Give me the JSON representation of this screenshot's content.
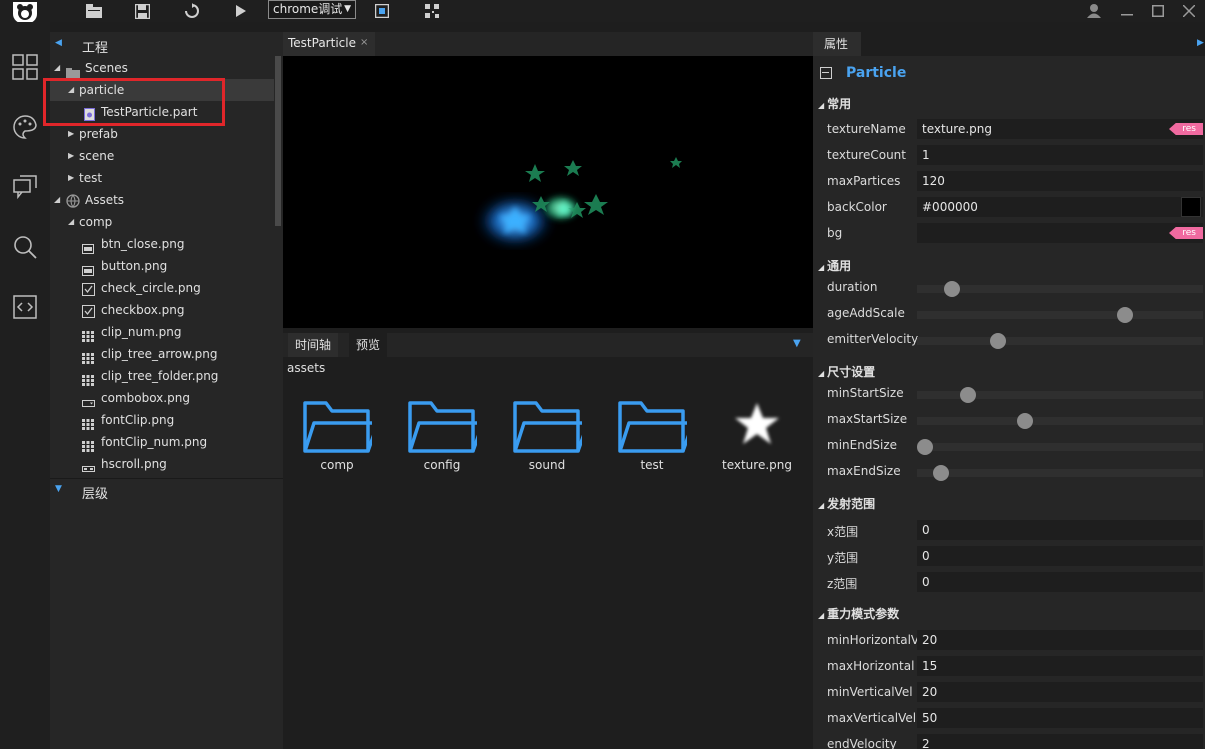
{
  "toolbar": {
    "select_value": "chrome调试",
    "caret": "▼"
  },
  "tree": {
    "header": "工程",
    "items": [
      {
        "label": "Scenes",
        "icon": "scenes-icon"
      },
      {
        "label": "particle"
      },
      {
        "label": "TestParticle.part",
        "icon": "particle-file-icon"
      },
      {
        "label": "prefab"
      },
      {
        "label": "scene"
      },
      {
        "label": "test"
      },
      {
        "label": "Assets",
        "icon": "globe-icon"
      },
      {
        "label": "comp"
      },
      {
        "label": "btn_close.png",
        "icon": "button-image-icon"
      },
      {
        "label": "button.png",
        "icon": "button-image-icon"
      },
      {
        "label": "check_circle.png",
        "icon": "checkbox-image-icon"
      },
      {
        "label": "checkbox.png",
        "icon": "checkbox-image-icon"
      },
      {
        "label": "clip_num.png",
        "icon": "clip-image-icon"
      },
      {
        "label": "clip_tree_arrow.png",
        "icon": "clip-image-icon"
      },
      {
        "label": "clip_tree_folder.png",
        "icon": "clip-image-icon"
      },
      {
        "label": "combobox.png",
        "icon": "combobox-image-icon"
      },
      {
        "label": "fontClip.png",
        "icon": "clip-image-icon"
      },
      {
        "label": "fontClip_num.png",
        "icon": "clip-image-icon"
      },
      {
        "label": "hscroll.png",
        "icon": "scroll-image-icon"
      }
    ],
    "layers_header": "层级"
  },
  "editor": {
    "tab_label": "TestParticle",
    "tab_close": "×"
  },
  "bottom": {
    "tabs": [
      "时间轴",
      "预览"
    ],
    "path": "assets",
    "assets": [
      {
        "label": "comp",
        "icon": "folder-icon"
      },
      {
        "label": "config",
        "icon": "folder-icon"
      },
      {
        "label": "sound",
        "icon": "folder-icon"
      },
      {
        "label": "test",
        "icon": "folder-icon"
      },
      {
        "label": "texture.png",
        "icon": "star-texture-icon"
      }
    ]
  },
  "props": {
    "tab": "属性",
    "component": "Particle",
    "sections": {
      "common": "常用",
      "general": "通用",
      "size": "尺寸设置",
      "emit": "发射范围",
      "gravity": "重力模式参数"
    },
    "res_tag": "res",
    "fields": {
      "textureName": {
        "label": "textureName",
        "value": "texture.png"
      },
      "textureCount": {
        "label": "textureCount",
        "value": "1"
      },
      "maxPartices": {
        "label": "maxPartices",
        "value": "120"
      },
      "backColor": {
        "label": "backColor",
        "value": "#000000"
      },
      "bg": {
        "label": "bg",
        "value": ""
      },
      "xRange": {
        "label": "x范围",
        "value": "0"
      },
      "yRange": {
        "label": "y范围",
        "value": "0"
      },
      "zRange": {
        "label": "z范围",
        "value": "0"
      },
      "minHorizontalV": {
        "label": "minHorizontalV",
        "value": "20"
      },
      "maxHorizontal": {
        "label": "maxHorizontal",
        "value": "15"
      },
      "minVerticalVel": {
        "label": "minVerticalVel",
        "value": "20"
      },
      "maxVerticalVel": {
        "label": "maxVerticalVel",
        "value": "50"
      },
      "endVelocity": {
        "label": "endVelocity",
        "value": "2"
      }
    },
    "sliders": {
      "duration": {
        "label": "duration",
        "fraction": 0.1
      },
      "ageAddScale": {
        "label": "ageAddScale",
        "fraction": 0.74
      },
      "emitterVelocity": {
        "label": "emitterVelocity",
        "fraction": 0.27
      },
      "minStartSize": {
        "label": "minStartSize",
        "fraction": 0.16
      },
      "maxStartSize": {
        "label": "maxStartSize",
        "fraction": 0.37
      },
      "minEndSize": {
        "label": "minEndSize",
        "fraction": 0.0
      },
      "maxEndSize": {
        "label": "maxEndSize",
        "fraction": 0.06
      }
    }
  },
  "colors": {
    "accent": "#4aa3f0",
    "highlight": "#e0262a",
    "res_tag": "#f06aa0"
  }
}
